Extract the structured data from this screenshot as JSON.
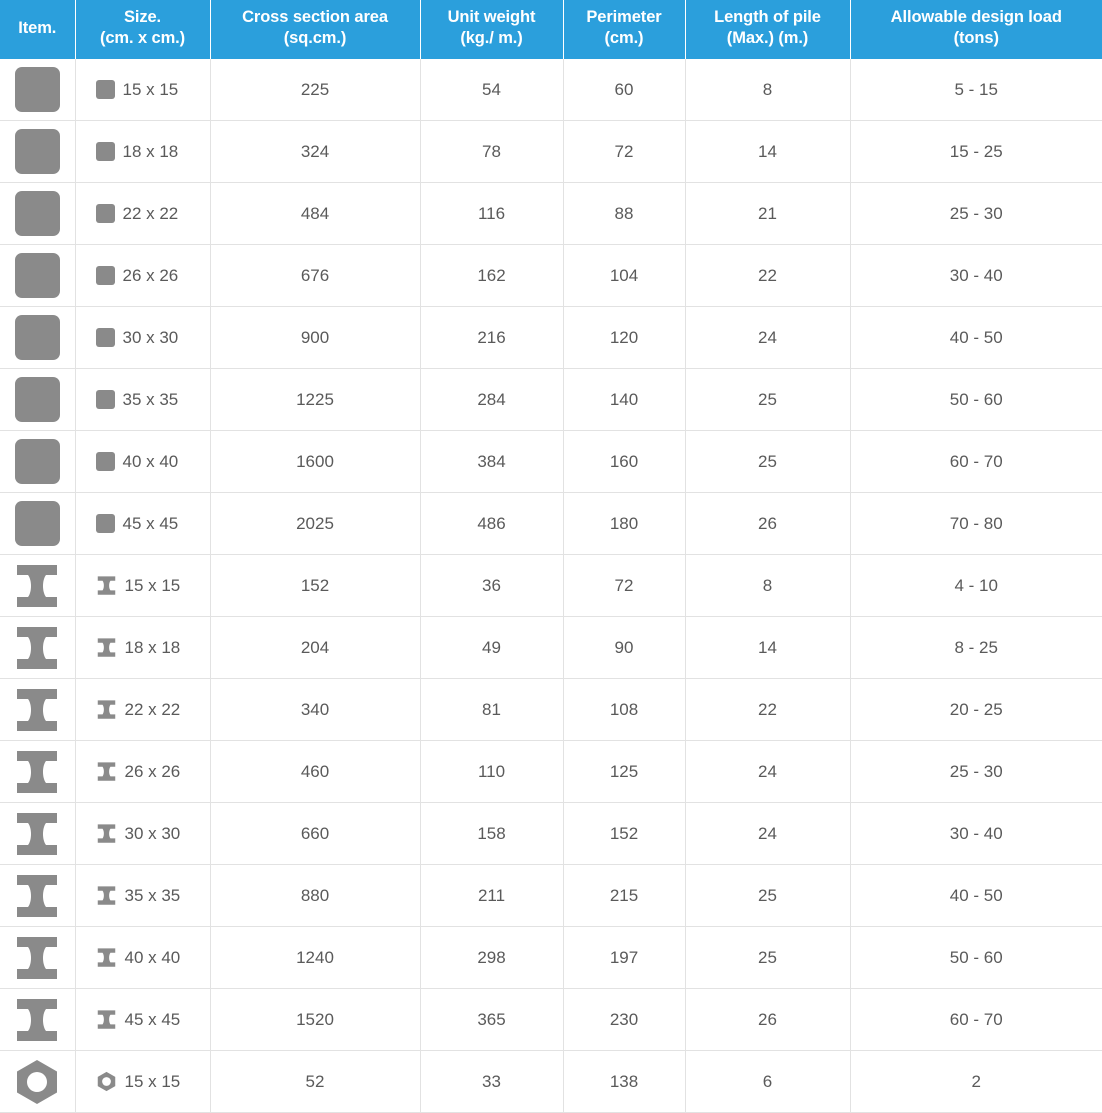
{
  "table": {
    "headers": [
      "Item.",
      "Size.\n(cm. x cm.)",
      "Cross section area\n(sq.cm.)",
      "Unit weight\n(kg./ m.)",
      "Perimeter\n(cm.)",
      "Length of pile\n(Max.) (m.)",
      "Allowable design load\n(tons)"
    ],
    "header_lines": [
      [
        "Item.",
        ""
      ],
      [
        "Size.",
        "(cm. x cm.)"
      ],
      [
        "Cross section area",
        "(sq.cm.)"
      ],
      [
        "Unit weight",
        "(kg./ m.)"
      ],
      [
        "Perimeter",
        "(cm.)"
      ],
      [
        "Length of pile",
        "(Max.) (m.)"
      ],
      [
        "Allowable design load",
        "(tons)"
      ]
    ],
    "rows": [
      {
        "shape": "square-pile-icon",
        "size": "15 x 15",
        "area": "225",
        "weight": "54",
        "perimeter": "60",
        "length": "8",
        "load": "5 - 15"
      },
      {
        "shape": "square-pile-icon",
        "size": "18 x 18",
        "area": "324",
        "weight": "78",
        "perimeter": "72",
        "length": "14",
        "load": "15 - 25"
      },
      {
        "shape": "square-pile-icon",
        "size": "22 x 22",
        "area": "484",
        "weight": "116",
        "perimeter": "88",
        "length": "21",
        "load": "25 - 30"
      },
      {
        "shape": "square-pile-icon",
        "size": "26 x 26",
        "area": "676",
        "weight": "162",
        "perimeter": "104",
        "length": "22",
        "load": "30 - 40"
      },
      {
        "shape": "square-pile-icon",
        "size": "30 x 30",
        "area": "900",
        "weight": "216",
        "perimeter": "120",
        "length": "24",
        "load": "40 - 50"
      },
      {
        "shape": "square-pile-icon",
        "size": "35 x 35",
        "area": "1225",
        "weight": "284",
        "perimeter": "140",
        "length": "25",
        "load": "50 - 60"
      },
      {
        "shape": "square-pile-icon",
        "size": "40 x 40",
        "area": "1600",
        "weight": "384",
        "perimeter": "160",
        "length": "25",
        "load": "60 - 70"
      },
      {
        "shape": "square-pile-icon",
        "size": "45 x 45",
        "area": "2025",
        "weight": "486",
        "perimeter": "180",
        "length": "26",
        "load": "70 - 80"
      },
      {
        "shape": "ibeam-pile-icon",
        "size": "15 x 15",
        "area": "152",
        "weight": "36",
        "perimeter": "72",
        "length": "8",
        "load": "4 - 10"
      },
      {
        "shape": "ibeam-pile-icon",
        "size": "18 x 18",
        "area": "204",
        "weight": "49",
        "perimeter": "90",
        "length": "14",
        "load": "8 - 25"
      },
      {
        "shape": "ibeam-pile-icon",
        "size": "22 x 22",
        "area": "340",
        "weight": "81",
        "perimeter": "108",
        "length": "22",
        "load": "20 - 25"
      },
      {
        "shape": "ibeam-pile-icon",
        "size": "26 x 26",
        "area": "460",
        "weight": "110",
        "perimeter": "125",
        "length": "24",
        "load": "25 - 30"
      },
      {
        "shape": "ibeam-pile-icon",
        "size": "30 x 30",
        "area": "660",
        "weight": "158",
        "perimeter": "152",
        "length": "24",
        "load": "30 - 40"
      },
      {
        "shape": "ibeam-pile-icon",
        "size": "35 x 35",
        "area": "880",
        "weight": "211",
        "perimeter": "215",
        "length": "25",
        "load": "40 - 50"
      },
      {
        "shape": "ibeam-pile-icon",
        "size": "40 x 40",
        "area": "1240",
        "weight": "298",
        "perimeter": "197",
        "length": "25",
        "load": "50 - 60"
      },
      {
        "shape": "ibeam-pile-icon",
        "size": "45 x 45",
        "area": "1520",
        "weight": "365",
        "perimeter": "230",
        "length": "26",
        "load": "60 - 70"
      },
      {
        "shape": "hexagon-pile-icon",
        "size": "15 x 15",
        "area": "52",
        "weight": "33",
        "perimeter": "138",
        "length": "6",
        "load": "2"
      }
    ]
  },
  "colors": {
    "header_bg": "#2b9fdc",
    "header_text": "#ffffff",
    "body_text": "#5a5a5a",
    "icon_gray": "#8a8a8a",
    "grid_line": "#e2e2e2"
  }
}
